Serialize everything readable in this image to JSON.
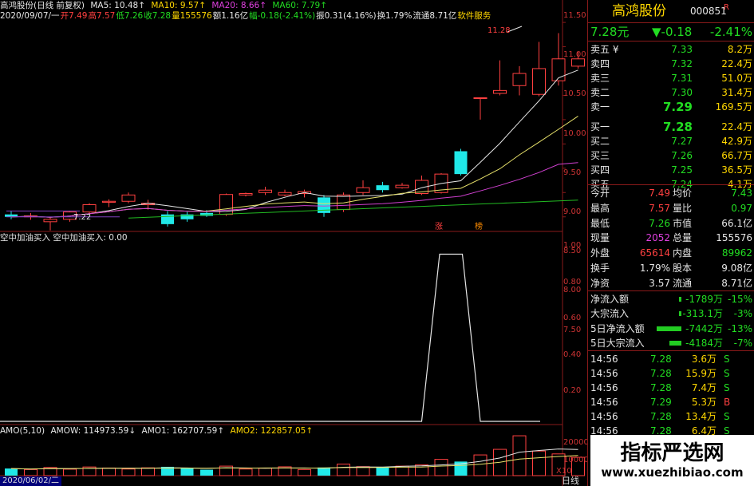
{
  "stock": {
    "name": "高鸿股份",
    "code": "000851",
    "badge": "R",
    "price": "7.28元",
    "change": "▼-0.18",
    "change_pct": "-2.41%"
  },
  "header_main": {
    "title": "高鸿股份(日线 前复权)",
    "ma5": "MA5: 10.48↑",
    "ma10": "MA10: 9.57↑",
    "ma20": "MA20: 8.66↑",
    "ma60": "MA60: 7.79↑"
  },
  "header_info": {
    "date": "2020/09/07/一",
    "open": "开7.49",
    "high": "高7.57",
    "low": "低7.26",
    "close": "收7.28",
    "vol": "量155576",
    "amount": "额1.16亿",
    "chg": "幅-0.18(-2.41%)",
    "amp": "振0.31(4.16%)",
    "turnover": "换1.79%",
    "float": "流通8.71亿",
    "service": "软件服务"
  },
  "header_ind": {
    "text": "空中加油买入  空中加油买入: 0.00"
  },
  "header_amo": {
    "label": "AMO(5,10)",
    "amow": "AMOW: 114973.59↓",
    "amo1": "AMO1: 162707.59↑",
    "amo2": "AMO2: 122857.05↑"
  },
  "price_axis": [
    "11.50",
    "11.00",
    "10.50",
    "10.00",
    "9.50",
    "9.00",
    "8.50",
    "8.00",
    "7.50"
  ],
  "ind_axis": [
    "1.00",
    "0.80",
    "0.60",
    "0.40",
    "0.20"
  ],
  "vol_axis": [
    "20000",
    "10000"
  ],
  "x10": "X10",
  "bottom_date": "2020/06/02/二",
  "period": "日线",
  "annot": {
    "high": "11.28",
    "low": "7.22",
    "zhang": "涨",
    "bang": "榜"
  },
  "order_book": [
    {
      "label": "卖五 ¥",
      "price": "7.33",
      "vol": "8.2万"
    },
    {
      "label": "卖四",
      "price": "7.32",
      "vol": "22.4万"
    },
    {
      "label": "卖三",
      "price": "7.31",
      "vol": "51.0万"
    },
    {
      "label": "卖二",
      "price": "7.30",
      "vol": "31.4万"
    },
    {
      "label": "卖一",
      "price": "7.29",
      "vol": "169.5万"
    },
    {
      "label": "买一",
      "price": "7.28",
      "vol": "22.4万"
    },
    {
      "label": "买二",
      "price": "7.27",
      "vol": "42.9万"
    },
    {
      "label": "买三",
      "price": "7.26",
      "vol": "66.7万"
    },
    {
      "label": "买四",
      "price": "7.25",
      "vol": "36.5万"
    },
    {
      "label": "买五",
      "price": "7.24",
      "vol": "4.1万"
    }
  ],
  "stats": [
    {
      "l1": "今开",
      "v1": "7.49",
      "l2": "均价",
      "v2": "7.43"
    },
    {
      "l1": "最高",
      "v1": "7.57",
      "l2": "量比",
      "v2": "0.97"
    },
    {
      "l1": "最低",
      "v1": "7.26",
      "l2": "市值",
      "v2": "66.1亿"
    },
    {
      "l1": "现量",
      "v1": "2052",
      "l2": "总量",
      "v2": "155576"
    },
    {
      "l1": "外盘",
      "v1": "65614",
      "l2": "内盘",
      "v2": "89962"
    },
    {
      "l1": "换手",
      "v1": "1.79%",
      "l2": "股本",
      "v2": "9.08亿"
    },
    {
      "l1": "净资",
      "v1": "3.57",
      "l2": "流通",
      "v2": "8.71亿"
    }
  ],
  "flows": [
    {
      "label": "净流入额",
      "value": "-1789万",
      "pct": "-15%",
      "bar": 0.06
    },
    {
      "label": "大宗流入",
      "value": "-313.1万",
      "pct": "-3%",
      "bar": 0.03
    },
    {
      "label": "5日净流入额",
      "value": "-7442万",
      "pct": "-13%",
      "bar": 0.9
    },
    {
      "label": "5日大宗流入",
      "value": "-4184万",
      "pct": "-7%",
      "bar": 0.45
    }
  ],
  "ticks": [
    {
      "time": "14:56",
      "price": "7.28",
      "vol": "3.6万",
      "side": "S"
    },
    {
      "time": "14:56",
      "price": "7.28",
      "vol": "15.9万",
      "side": "S"
    },
    {
      "time": "14:56",
      "price": "7.28",
      "vol": "7.4万",
      "side": "S"
    },
    {
      "time": "14:56",
      "price": "7.29",
      "vol": "5.3万",
      "side": "B"
    },
    {
      "time": "14:56",
      "price": "7.28",
      "vol": "13.4万",
      "side": "S"
    },
    {
      "time": "14:56",
      "price": "7.28",
      "vol": "6.4万",
      "side": "S"
    }
  ],
  "watermark": {
    "title": "指标严选网",
    "url": "www.xuezhibiao.com"
  },
  "chart_data": {
    "type": "candlestick",
    "candles": [
      {
        "o": 7.55,
        "h": 7.62,
        "l": 7.45,
        "c": 7.5
      },
      {
        "o": 7.5,
        "h": 7.58,
        "l": 7.44,
        "c": 7.52
      },
      {
        "o": 7.4,
        "h": 7.5,
        "l": 7.22,
        "c": 7.45
      },
      {
        "o": 7.45,
        "h": 7.62,
        "l": 7.4,
        "c": 7.6
      },
      {
        "o": 7.6,
        "h": 7.78,
        "l": 7.55,
        "c": 7.75
      },
      {
        "o": 7.8,
        "h": 7.86,
        "l": 7.7,
        "c": 7.82
      },
      {
        "o": 7.82,
        "h": 8.0,
        "l": 7.78,
        "c": 7.95
      },
      {
        "o": 7.75,
        "h": 7.85,
        "l": 7.65,
        "c": 7.78
      },
      {
        "o": 7.55,
        "h": 7.62,
        "l": 7.3,
        "c": 7.35
      },
      {
        "o": 7.55,
        "h": 7.6,
        "l": 7.4,
        "c": 7.45
      },
      {
        "o": 7.58,
        "h": 7.64,
        "l": 7.5,
        "c": 7.52
      },
      {
        "o": 7.55,
        "h": 7.98,
        "l": 7.52,
        "c": 7.96
      },
      {
        "o": 7.95,
        "h": 8.0,
        "l": 7.92,
        "c": 7.98
      },
      {
        "o": 8.0,
        "h": 8.12,
        "l": 7.95,
        "c": 8.05
      },
      {
        "o": 7.95,
        "h": 8.06,
        "l": 7.92,
        "c": 8.0
      },
      {
        "o": 7.98,
        "h": 8.06,
        "l": 7.9,
        "c": 8.02
      },
      {
        "o": 7.9,
        "h": 7.95,
        "l": 7.5,
        "c": 7.58
      },
      {
        "o": 7.65,
        "h": 8.0,
        "l": 7.6,
        "c": 7.95
      },
      {
        "o": 8.0,
        "h": 8.25,
        "l": 7.95,
        "c": 8.1
      },
      {
        "o": 8.15,
        "h": 8.22,
        "l": 8.0,
        "c": 8.05
      },
      {
        "o": 8.1,
        "h": 8.2,
        "l": 8.08,
        "c": 8.15
      },
      {
        "o": 7.98,
        "h": 8.35,
        "l": 7.95,
        "c": 8.25
      },
      {
        "o": 8.0,
        "h": 8.4,
        "l": 7.98,
        "c": 8.38
      },
      {
        "o": 8.85,
        "h": 8.9,
        "l": 8.35,
        "c": 8.38
      },
      {
        "o": 9.95,
        "h": 9.95,
        "l": 9.5,
        "c": 9.95
      },
      {
        "o": 10.04,
        "h": 10.72,
        "l": 10.0,
        "c": 10.1
      },
      {
        "o": 10.2,
        "h": 10.6,
        "l": 10.0,
        "c": 10.45
      },
      {
        "o": 10.02,
        "h": 11.1,
        "l": 9.98,
        "c": 10.55
      },
      {
        "o": 10.3,
        "h": 11.28,
        "l": 10.2,
        "c": 10.75
      },
      {
        "o": 10.6,
        "h": 10.9,
        "l": 10.55,
        "c": 10.75
      }
    ],
    "ind": [
      0,
      0,
      0,
      0,
      0,
      0,
      0,
      0,
      0,
      0,
      0,
      0,
      0,
      0,
      0,
      0,
      0,
      0,
      0,
      0,
      0,
      0,
      1,
      1,
      0,
      0,
      0,
      0,
      0,
      0
    ],
    "vol": [
      4200,
      3600,
      4800,
      3800,
      5100,
      4500,
      3900,
      4600,
      5200,
      4300,
      3500,
      5600,
      3900,
      4400,
      5200,
      3600,
      4800,
      6800,
      5300,
      4700,
      5600,
      6300,
      9600,
      8300,
      12200,
      15500,
      23500,
      14500,
      12800,
      10800
    ],
    "ylim": [
      7.2,
      11.6
    ],
    "ind_ylim": [
      0,
      1.05
    ]
  }
}
